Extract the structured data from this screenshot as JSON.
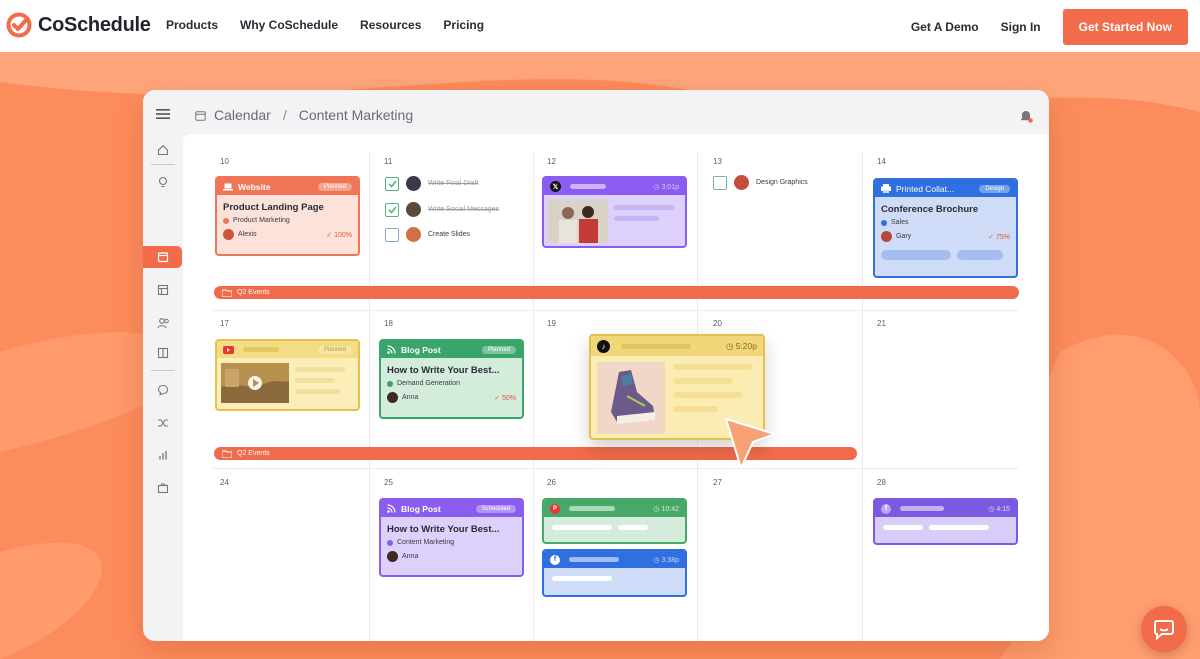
{
  "nav": {
    "logo_text": "CoSchedule",
    "links": [
      "Products",
      "Why CoSchedule",
      "Resources",
      "Pricing"
    ],
    "demo": "Get A Demo",
    "signin": "Sign In",
    "cta": "Get Started Now"
  },
  "app": {
    "breadcrumb_root": "Calendar",
    "breadcrumb_sep": "/",
    "breadcrumb_page": "Content Marketing"
  },
  "days": {
    "d10": "10",
    "d11": "11",
    "d12": "12",
    "d13": "13",
    "d14": "14",
    "d17": "17",
    "d18": "18",
    "d19": "19",
    "d20": "20",
    "d21": "21",
    "d24": "24",
    "d25": "25",
    "d26": "26",
    "d27": "27",
    "d28": "28"
  },
  "cards": {
    "website": {
      "type": "Website",
      "status": "Planned",
      "title": "Product Landing Page",
      "tag": "Product Marketing",
      "owner": "Alexis",
      "progress": "100%"
    },
    "x_post": {
      "time": "3:01p"
    },
    "print": {
      "type": "Printed Collat...",
      "status": "Design",
      "title": "Conference Brochure",
      "tag": "Sales",
      "owner": "Gary",
      "progress": "75%"
    },
    "youtube": {
      "status": "Planned"
    },
    "blog1": {
      "type": "Blog Post",
      "status": "Planned",
      "title": "How to Write Your Best...",
      "tag": "Demand Generation",
      "owner": "Anna",
      "progress": "50%"
    },
    "tiktok": {
      "time": "5:20p"
    },
    "blog2": {
      "type": "Blog Post",
      "status": "Scheduled",
      "title": "How to Write Your Best...",
      "tag": "Content Marketing",
      "owner": "Anna"
    },
    "pinterest": {
      "time": "10:42"
    },
    "facebook1": {
      "time": "3:38p"
    },
    "facebook2": {
      "time": "4:15"
    }
  },
  "tasks": {
    "t1": "Write Final Draft",
    "t2": "Write Social Messages",
    "t3": "Create Slides",
    "t4": "Design Graphics"
  },
  "events": {
    "e1": "Q2 Events",
    "e2": "Q2 Events"
  },
  "colors": {
    "brand": "#f26b4a",
    "website": "#ef7556",
    "social_purple": "#8a5cf0",
    "print_blue": "#2f6fe0",
    "youtube_yellow": "#e7c24a",
    "blog_green": "#3aa56a",
    "pinterest_green": "#47a868"
  }
}
